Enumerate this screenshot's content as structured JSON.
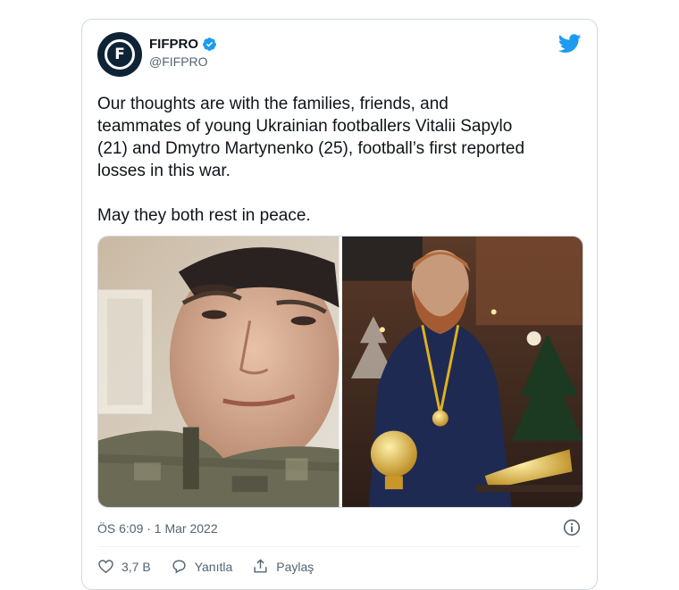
{
  "tweet": {
    "display_name": "FIFPRO",
    "handle": "@FIFPRO",
    "avatar_letter": "F",
    "body": "Our thoughts are with the families, friends, and\nteammates of young Ukrainian footballers Vitalii Sapylo\n(21) and Dmytro Martynenko (25), football’s first reported\nlosses in this war.\n\nMay they both rest in peace.",
    "timestamp": "ÖS 6:09 · 1 Mar 2022",
    "likes": "3,7 B",
    "reply_label": "Yanıtla",
    "share_label": "Paylaş"
  },
  "icons": {
    "verified": "verified-badge-icon",
    "brand": "twitter-bird-icon",
    "info": "info-icon",
    "like": "heart-icon",
    "reply": "reply-bubble-icon",
    "share": "share-icon"
  },
  "colors": {
    "accent": "#1d9bf0",
    "text": "#0f1419",
    "secondary": "#536471",
    "border": "#cfd9de"
  }
}
